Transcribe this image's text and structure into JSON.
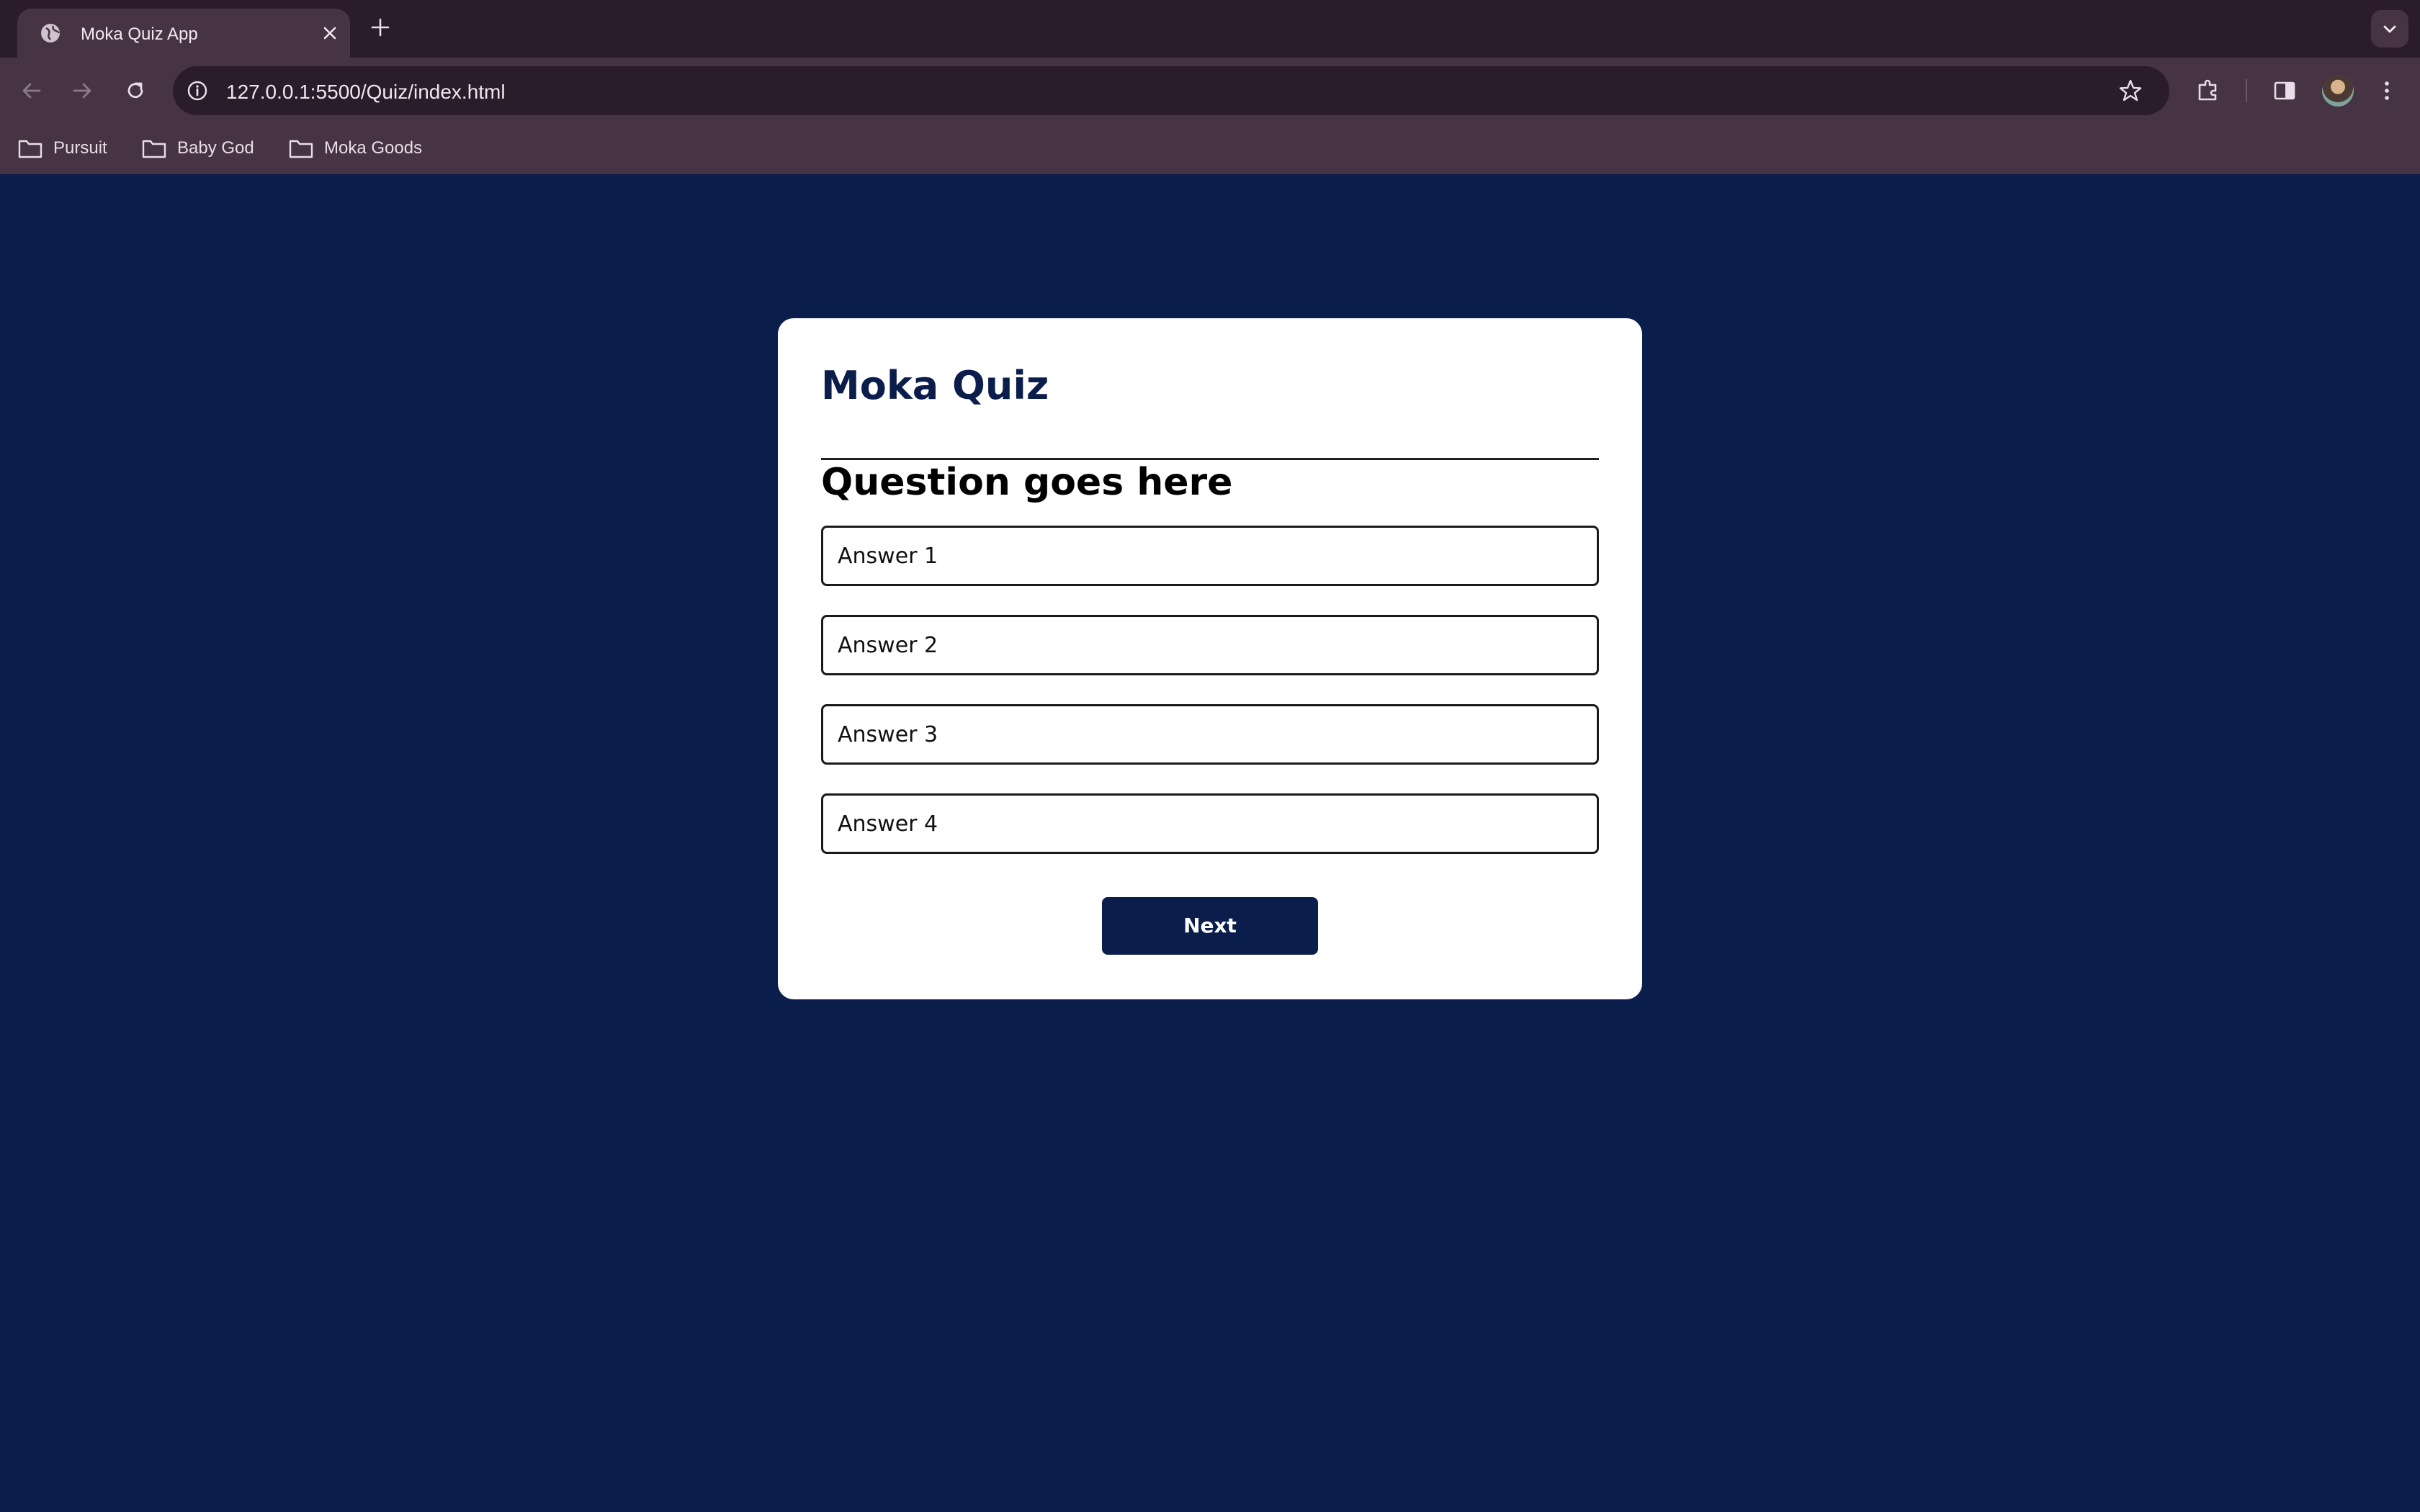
{
  "browser": {
    "tab_title": "Moka Quiz App",
    "url": "127.0.0.1:5500/Quiz/index.html",
    "bookmarks": [
      {
        "label": "Pursuit",
        "icon": "folder-icon"
      },
      {
        "label": "Baby God",
        "icon": "folder-icon"
      },
      {
        "label": "Moka Goods",
        "icon": "folder-icon"
      }
    ],
    "colors": {
      "tabstrip": "#2b1c2b",
      "toolbar": "#463444"
    }
  },
  "quiz": {
    "title": "Moka Quiz",
    "question": "Question goes here",
    "answers": [
      "Answer 1",
      "Answer 2",
      "Answer 3",
      "Answer 4"
    ],
    "next_label": "Next"
  },
  "colors": {
    "page_background": "#0a1d4b",
    "card_background": "#ffffff",
    "accent": "#0a1d4b"
  }
}
